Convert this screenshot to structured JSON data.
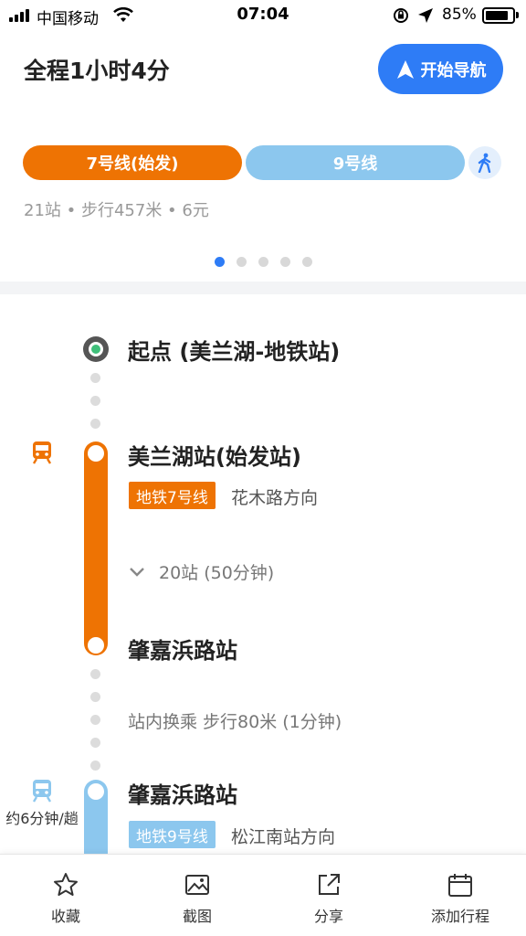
{
  "status_bar": {
    "carrier": "中国移动",
    "time": "07:04",
    "battery_percent": "85%",
    "battery_level": 0.85,
    "icons": [
      "signal-icon",
      "wifi-icon",
      "orientation-lock-icon",
      "location-arrow-icon",
      "battery-icon"
    ]
  },
  "header": {
    "title": "全程1小时4分",
    "nav_button_label": "开始导航"
  },
  "segments": [
    {
      "label": "7号线(始发)",
      "color": "#ee7303"
    },
    {
      "label": "9号线",
      "color": "#8cc7ee"
    }
  ],
  "summary": "21站 • 步行457米 • 6元",
  "pager": {
    "count": 5,
    "active": 1
  },
  "timeline": {
    "origin": "起点 (美兰湖-地铁站)",
    "stop1": {
      "name": "美兰湖站(始发站)",
      "line_tag": "地铁7号线",
      "direction": "花木路方向",
      "stops_info": "20站 (50分钟)"
    },
    "stop2": {
      "name": "肇嘉浜路站"
    },
    "transfer": "站内换乘 步行80米 (1分钟)",
    "stop3": {
      "name": "肇嘉浜路站",
      "line_tag": "地铁9号线",
      "direction": "松江南站方向",
      "frequency": "约6分钟/趟"
    }
  },
  "toolbar": {
    "items": [
      {
        "label": "收藏",
        "icon": "star-icon"
      },
      {
        "label": "截图",
        "icon": "image-icon"
      },
      {
        "label": "分享",
        "icon": "share-icon"
      },
      {
        "label": "添加行程",
        "icon": "calendar-icon"
      }
    ]
  }
}
